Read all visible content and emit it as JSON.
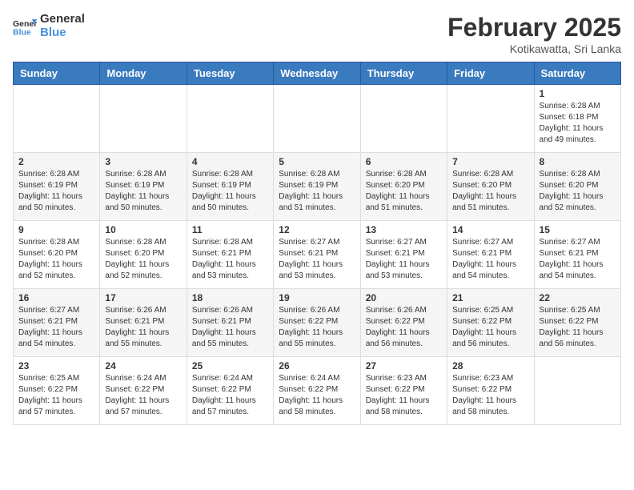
{
  "header": {
    "logo_general": "General",
    "logo_blue": "Blue",
    "month_year": "February 2025",
    "location": "Kotikawatta, Sri Lanka"
  },
  "weekdays": [
    "Sunday",
    "Monday",
    "Tuesday",
    "Wednesday",
    "Thursday",
    "Friday",
    "Saturday"
  ],
  "weeks": [
    [
      {
        "day": "",
        "info": ""
      },
      {
        "day": "",
        "info": ""
      },
      {
        "day": "",
        "info": ""
      },
      {
        "day": "",
        "info": ""
      },
      {
        "day": "",
        "info": ""
      },
      {
        "day": "",
        "info": ""
      },
      {
        "day": "1",
        "info": "Sunrise: 6:28 AM\nSunset: 6:18 PM\nDaylight: 11 hours and 49 minutes."
      }
    ],
    [
      {
        "day": "2",
        "info": "Sunrise: 6:28 AM\nSunset: 6:19 PM\nDaylight: 11 hours and 50 minutes."
      },
      {
        "day": "3",
        "info": "Sunrise: 6:28 AM\nSunset: 6:19 PM\nDaylight: 11 hours and 50 minutes."
      },
      {
        "day": "4",
        "info": "Sunrise: 6:28 AM\nSunset: 6:19 PM\nDaylight: 11 hours and 50 minutes."
      },
      {
        "day": "5",
        "info": "Sunrise: 6:28 AM\nSunset: 6:19 PM\nDaylight: 11 hours and 51 minutes."
      },
      {
        "day": "6",
        "info": "Sunrise: 6:28 AM\nSunset: 6:20 PM\nDaylight: 11 hours and 51 minutes."
      },
      {
        "day": "7",
        "info": "Sunrise: 6:28 AM\nSunset: 6:20 PM\nDaylight: 11 hours and 51 minutes."
      },
      {
        "day": "8",
        "info": "Sunrise: 6:28 AM\nSunset: 6:20 PM\nDaylight: 11 hours and 52 minutes."
      }
    ],
    [
      {
        "day": "9",
        "info": "Sunrise: 6:28 AM\nSunset: 6:20 PM\nDaylight: 11 hours and 52 minutes."
      },
      {
        "day": "10",
        "info": "Sunrise: 6:28 AM\nSunset: 6:20 PM\nDaylight: 11 hours and 52 minutes."
      },
      {
        "day": "11",
        "info": "Sunrise: 6:28 AM\nSunset: 6:21 PM\nDaylight: 11 hours and 53 minutes."
      },
      {
        "day": "12",
        "info": "Sunrise: 6:27 AM\nSunset: 6:21 PM\nDaylight: 11 hours and 53 minutes."
      },
      {
        "day": "13",
        "info": "Sunrise: 6:27 AM\nSunset: 6:21 PM\nDaylight: 11 hours and 53 minutes."
      },
      {
        "day": "14",
        "info": "Sunrise: 6:27 AM\nSunset: 6:21 PM\nDaylight: 11 hours and 54 minutes."
      },
      {
        "day": "15",
        "info": "Sunrise: 6:27 AM\nSunset: 6:21 PM\nDaylight: 11 hours and 54 minutes."
      }
    ],
    [
      {
        "day": "16",
        "info": "Sunrise: 6:27 AM\nSunset: 6:21 PM\nDaylight: 11 hours and 54 minutes."
      },
      {
        "day": "17",
        "info": "Sunrise: 6:26 AM\nSunset: 6:21 PM\nDaylight: 11 hours and 55 minutes."
      },
      {
        "day": "18",
        "info": "Sunrise: 6:26 AM\nSunset: 6:21 PM\nDaylight: 11 hours and 55 minutes."
      },
      {
        "day": "19",
        "info": "Sunrise: 6:26 AM\nSunset: 6:22 PM\nDaylight: 11 hours and 55 minutes."
      },
      {
        "day": "20",
        "info": "Sunrise: 6:26 AM\nSunset: 6:22 PM\nDaylight: 11 hours and 56 minutes."
      },
      {
        "day": "21",
        "info": "Sunrise: 6:25 AM\nSunset: 6:22 PM\nDaylight: 11 hours and 56 minutes."
      },
      {
        "day": "22",
        "info": "Sunrise: 6:25 AM\nSunset: 6:22 PM\nDaylight: 11 hours and 56 minutes."
      }
    ],
    [
      {
        "day": "23",
        "info": "Sunrise: 6:25 AM\nSunset: 6:22 PM\nDaylight: 11 hours and 57 minutes."
      },
      {
        "day": "24",
        "info": "Sunrise: 6:24 AM\nSunset: 6:22 PM\nDaylight: 11 hours and 57 minutes."
      },
      {
        "day": "25",
        "info": "Sunrise: 6:24 AM\nSunset: 6:22 PM\nDaylight: 11 hours and 57 minutes."
      },
      {
        "day": "26",
        "info": "Sunrise: 6:24 AM\nSunset: 6:22 PM\nDaylight: 11 hours and 58 minutes."
      },
      {
        "day": "27",
        "info": "Sunrise: 6:23 AM\nSunset: 6:22 PM\nDaylight: 11 hours and 58 minutes."
      },
      {
        "day": "28",
        "info": "Sunrise: 6:23 AM\nSunset: 6:22 PM\nDaylight: 11 hours and 58 minutes."
      },
      {
        "day": "",
        "info": ""
      }
    ]
  ]
}
